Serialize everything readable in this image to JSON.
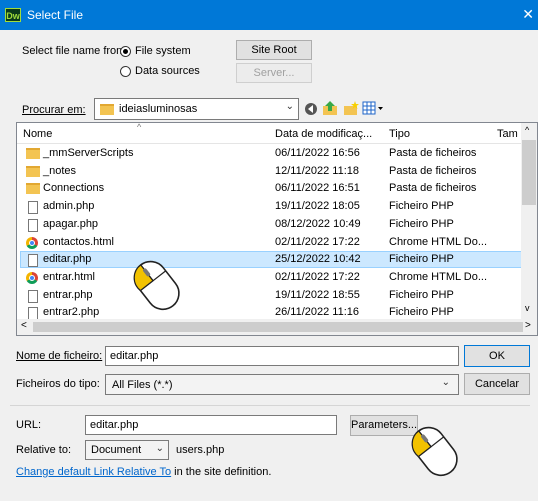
{
  "window": {
    "title": "Select File",
    "app_logo": "Dw",
    "close_glyph": "✕"
  },
  "source": {
    "label": "Select file name from:",
    "options": [
      "File system",
      "Data sources"
    ],
    "selected": "File system",
    "site_root_button": "Site Root",
    "server_button": "Server..."
  },
  "lookin": {
    "label": "Procurar em:",
    "value": "ideiasluminosas",
    "toolbar_icons": [
      "back-icon",
      "up-folder-icon",
      "new-folder-icon",
      "view-menu-icon"
    ]
  },
  "files": {
    "columns": [
      "Nome",
      "Data de modificaç...",
      "Tipo",
      "Tam"
    ],
    "rows": [
      {
        "name": "_mmServerScripts",
        "date": "06/11/2022 16:56",
        "type": "Pasta de ficheiros",
        "icon": "folder-icon"
      },
      {
        "name": "_notes",
        "date": "12/11/2022 11:18",
        "type": "Pasta de ficheiros",
        "icon": "folder-icon"
      },
      {
        "name": "Connections",
        "date": "06/11/2022 16:51",
        "type": "Pasta de ficheiros",
        "icon": "folder-icon"
      },
      {
        "name": "admin.php",
        "date": "19/11/2022 18:05",
        "type": "Ficheiro PHP",
        "icon": "file-icon"
      },
      {
        "name": "apagar.php",
        "date": "08/12/2022 10:49",
        "type": "Ficheiro PHP",
        "icon": "file-icon"
      },
      {
        "name": "contactos.html",
        "date": "02/11/2022 17:22",
        "type": "Chrome HTML Do...",
        "icon": "chrome-icon"
      },
      {
        "name": "editar.php",
        "date": "25/12/2022 10:42",
        "type": "Ficheiro PHP",
        "icon": "file-icon",
        "selected": true
      },
      {
        "name": "entrar.html",
        "date": "02/11/2022 17:22",
        "type": "Chrome HTML Do...",
        "icon": "chrome-icon"
      },
      {
        "name": "entrar.php",
        "date": "19/11/2022 18:55",
        "type": "Ficheiro PHP",
        "icon": "file-icon"
      },
      {
        "name": "entrar2.php",
        "date": "26/11/2022 11:16",
        "type": "Ficheiro PHP",
        "icon": "file-icon"
      }
    ]
  },
  "filename": {
    "label": "Nome de ficheiro:",
    "value": "editar.php",
    "ok_button": "OK"
  },
  "filetype": {
    "label": "Ficheiros do tipo:",
    "value": "All Files (*.*)",
    "cancel_button": "Cancelar"
  },
  "url": {
    "label": "URL:",
    "value": "editar.php",
    "parameters_button": "Parameters..."
  },
  "relative": {
    "label": "Relative to:",
    "value": "Document",
    "file": "users.php"
  },
  "footer": {
    "link_text": "Change default Link Relative To",
    "suffix": " in the site definition."
  },
  "colors": {
    "titlebar": "#0078d7",
    "selection": "#cce8ff",
    "link": "#0066cc"
  }
}
